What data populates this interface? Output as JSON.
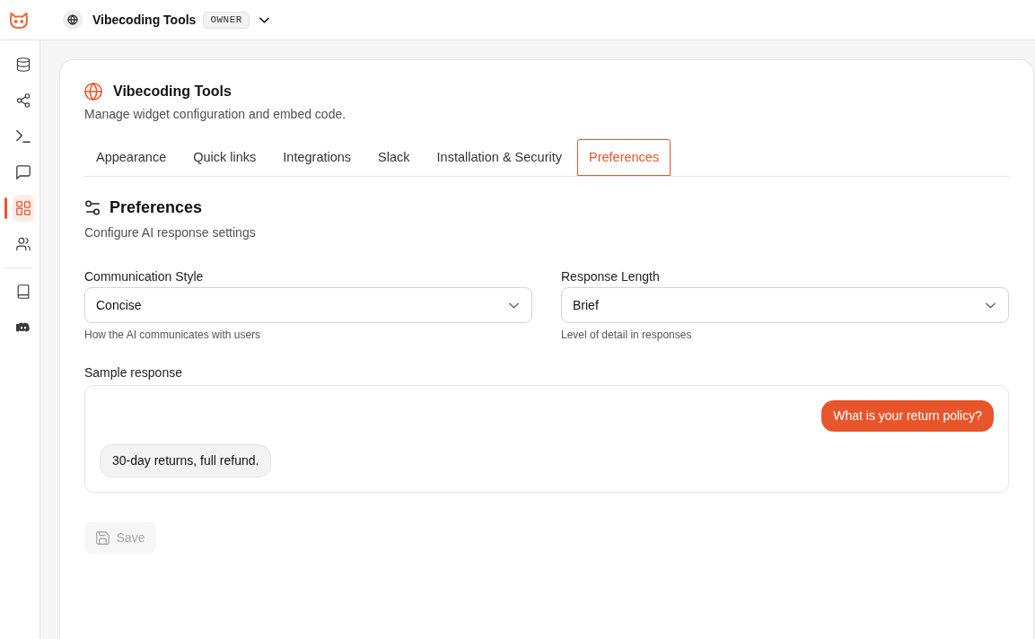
{
  "workspace": {
    "name": "Vibecoding Tools",
    "role": "OWNER"
  },
  "sidebar": {
    "items": [
      {
        "kind": "database",
        "selected": false
      },
      {
        "kind": "share",
        "selected": false
      },
      {
        "kind": "terminal",
        "selected": false
      },
      {
        "kind": "chat",
        "selected": false
      },
      {
        "kind": "dashboard",
        "selected": true
      },
      {
        "kind": "users",
        "selected": false
      }
    ],
    "footer_items": [
      {
        "kind": "book",
        "selected": false
      },
      {
        "kind": "controller",
        "selected": false
      }
    ]
  },
  "page": {
    "title": "Vibecoding Tools",
    "subtitle": "Manage widget configuration and embed code."
  },
  "tabs": [
    {
      "label": "Appearance",
      "selected": false
    },
    {
      "label": "Quick links",
      "selected": false
    },
    {
      "label": "Integrations",
      "selected": false
    },
    {
      "label": "Slack",
      "selected": false
    },
    {
      "label": "Installation & Security",
      "selected": false
    },
    {
      "label": "Preferences",
      "selected": true
    }
  ],
  "section": {
    "title": "Preferences",
    "subtitle": "Configure AI response settings"
  },
  "fields": [
    {
      "label": "Communication Style",
      "value": "Concise",
      "help": "How the AI communicates with users"
    },
    {
      "label": "Response Length",
      "value": "Brief",
      "help": "Level of detail in responses"
    }
  ],
  "sample": {
    "label": "Sample response",
    "messages": [
      {
        "kind": "user",
        "text": "What is your return policy?"
      },
      {
        "kind": "assistant",
        "text": "30-day returns, full refund."
      }
    ]
  },
  "save_button": {
    "label": "Save",
    "disabled": true
  }
}
